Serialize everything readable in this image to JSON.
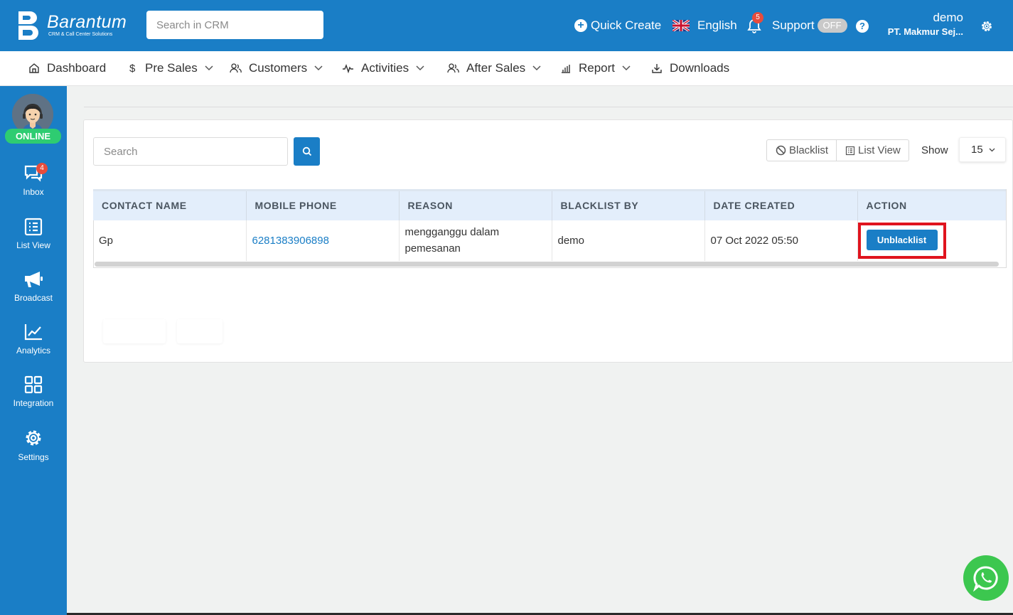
{
  "app": {
    "logo_name": "Barantum",
    "logo_sub": "CRM & Call Center Solutions",
    "search_placeholder": "Search in CRM"
  },
  "topbar": {
    "quick_create": "Quick Create",
    "language": "English",
    "notification_count": "5",
    "support_label": "Support",
    "support_toggle": "OFF",
    "help": "?",
    "user_name": "demo",
    "company": "PT. Makmur Sej..."
  },
  "nav": {
    "items": [
      {
        "label": "Dashboard",
        "icon": "home-icon"
      },
      {
        "label": "Pre Sales",
        "icon": "dollar-icon"
      },
      {
        "label": "Customers",
        "icon": "users-icon"
      },
      {
        "label": "Activities",
        "icon": "activity-icon"
      },
      {
        "label": "After Sales",
        "icon": "users-icon"
      },
      {
        "label": "Report",
        "icon": "bar-chart-icon"
      },
      {
        "label": "Downloads",
        "icon": "download-icon"
      }
    ]
  },
  "sidebar": {
    "status": "ONLINE",
    "inbox_badge": "4",
    "items": [
      {
        "label": "Inbox",
        "icon": "chat-icon"
      },
      {
        "label": "List View",
        "icon": "list-icon"
      },
      {
        "label": "Broadcast",
        "icon": "megaphone-icon"
      },
      {
        "label": "Analytics",
        "icon": "line-chart-icon"
      },
      {
        "label": "Integration",
        "icon": "grid-icon"
      },
      {
        "label": "Settings",
        "icon": "gear-icon"
      }
    ]
  },
  "toolbar": {
    "search_placeholder": "Search",
    "blacklist_label": "Blacklist",
    "listview_label": "List View",
    "show_label": "Show",
    "show_value": "15"
  },
  "table": {
    "headers": [
      "CONTACT NAME",
      "MOBILE PHONE",
      "REASON",
      "BLACKLIST BY",
      "DATE CREATED",
      "ACTION"
    ],
    "rows": [
      {
        "contact_name": "Gp",
        "mobile_phone": "6281383906898",
        "reason": "mengganggu dalam pemesanan",
        "blacklist_by": "demo",
        "date_created": "07 Oct 2022 05:50",
        "action": "Unblacklist"
      }
    ]
  },
  "colors": {
    "brand": "#1a7ec6",
    "online": "#2ecc71",
    "highlight": "#e0141e",
    "whatsapp": "#3cc74f"
  }
}
